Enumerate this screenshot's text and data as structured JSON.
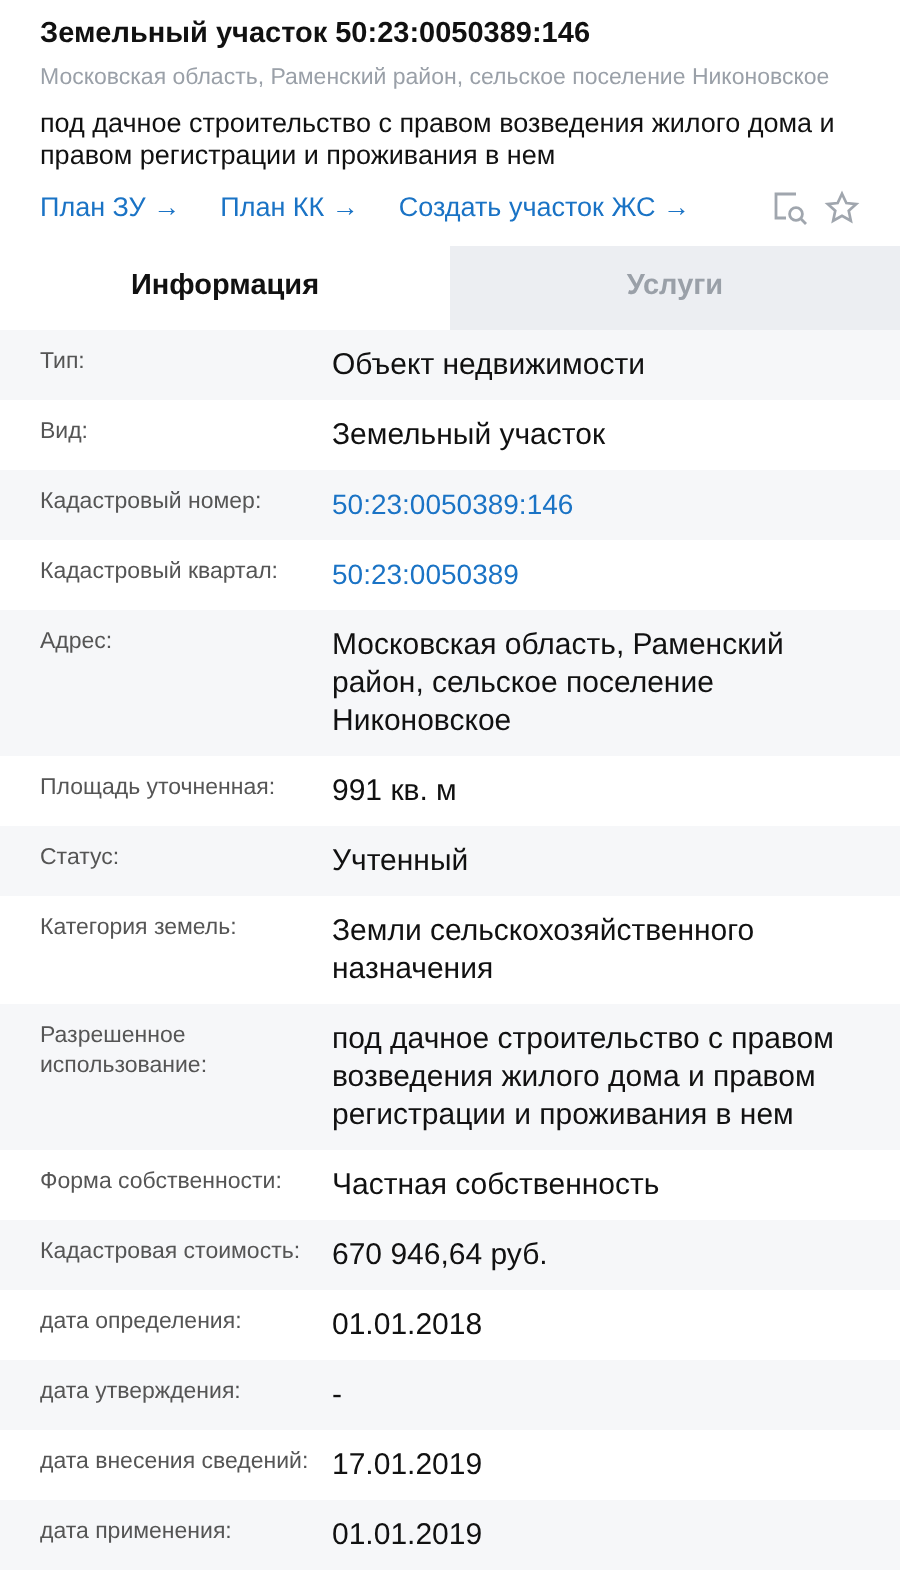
{
  "header": {
    "title": "Земельный участок 50:23:0050389:146",
    "address": "Московская область, Раменский район, сельское поселение Никоновское",
    "description": "под дачное строительство с правом возведения жилого дома и правом регистрации и проживания в нем",
    "links": [
      "План ЗУ →",
      "План КК →",
      "Создать участок ЖС →"
    ]
  },
  "tabs": [
    {
      "label": "Информация",
      "selected": true
    },
    {
      "label": "Услуги",
      "selected": false
    }
  ],
  "rows": [
    {
      "label": "Тип:",
      "value": "Объект недвижимости",
      "kind": "text"
    },
    {
      "label": "Вид:",
      "value": "Земельный участок",
      "kind": "text"
    },
    {
      "label": "Кадастровый номер:",
      "value": "50:23:0050389:146",
      "kind": "link"
    },
    {
      "label": "Кадастровый квартал:",
      "value": "50:23:0050389",
      "kind": "link"
    },
    {
      "label": "Адрес:",
      "value": "Московская область, Раменский район, сельское поселение Никоновское",
      "kind": "text"
    },
    {
      "label": "Площадь уточненная:",
      "value": "991 кв. м",
      "kind": "text"
    },
    {
      "label": "Статус:",
      "value": "Учтенный",
      "kind": "text"
    },
    {
      "label": "Категория земель:",
      "value": "Земли сельскохозяйственного назначения",
      "kind": "text"
    },
    {
      "label": "Разрешенное использование:",
      "value": "под дачное строительство с правом возведения жилого дома и правом регистрации и проживания в нем",
      "kind": "text"
    },
    {
      "label": "Форма собственности:",
      "value": "Частная собственность",
      "kind": "text"
    },
    {
      "label": "Кадастровая стоимость:",
      "value": "670 946,64 руб.",
      "kind": "text"
    },
    {
      "label": "дата определения:",
      "value": "01.01.2018",
      "kind": "text"
    },
    {
      "label": "дата утверждения:",
      "value": "-",
      "kind": "text"
    },
    {
      "label": "дата внесения сведений:",
      "value": "17.01.2019",
      "kind": "text"
    },
    {
      "label": "дата применения:",
      "value": "01.01.2019",
      "kind": "text"
    }
  ]
}
